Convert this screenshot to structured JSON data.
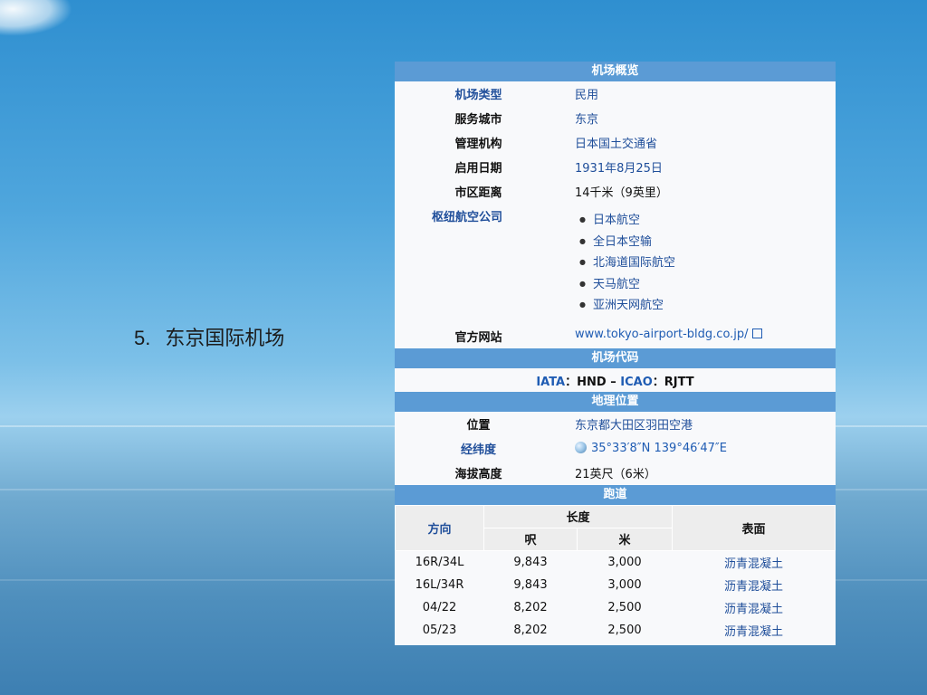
{
  "slide": {
    "number": "5.",
    "title": "东京国际机场"
  },
  "infobox": {
    "header_overview": "机场概览",
    "rows": [
      {
        "label": "机场类型",
        "value": "民用",
        "label_link": true,
        "value_link": true
      },
      {
        "label": "服务城市",
        "value": "东京",
        "label_link": false,
        "value_link": true
      },
      {
        "label": "管理机构",
        "value": "日本国土交通省",
        "label_link": false,
        "value_link": true
      },
      {
        "label": "启用日期",
        "value": "1931年8月25日",
        "label_link": false,
        "value_link": true
      },
      {
        "label": "市区距离",
        "value": "14千米（9英里）",
        "label_link": false,
        "value_link": false
      }
    ],
    "hub_label": "枢纽航空公司",
    "hubs": [
      "日本航空",
      "全日本空输",
      "北海道国际航空",
      "天马航空",
      "亚洲天网航空"
    ],
    "website_label": "官方网站",
    "website": "www.tokyo-airport-bldg.co.jp/",
    "header_codes": "机场代码",
    "codes": {
      "iata_label": "IATA",
      "iata_sep": "：",
      "iata": "HND",
      "dash": " – ",
      "icao_label": "ICAO",
      "icao_sep": "：",
      "icao": "RJTT"
    },
    "header_geo": "地理位置",
    "geo": {
      "location_label": "位置",
      "location": "东京都大田区羽田空港",
      "coord_label": "经纬度",
      "coord": "35°33′8″N 139°46′47″E",
      "elev_label": "海拔高度",
      "elev": "21英尺（6米）"
    },
    "header_runways": "跑道",
    "runway_head": {
      "direction": "方向",
      "length": "长度",
      "surface": "表面",
      "ft": "呎",
      "m": "米"
    },
    "runways": [
      {
        "dir": "16R/34L",
        "ft": "9,843",
        "m": "3,000",
        "surface": "沥青混凝土"
      },
      {
        "dir": "16L/34R",
        "ft": "9,843",
        "m": "3,000",
        "surface": "沥青混凝土"
      },
      {
        "dir": "04/22",
        "ft": "8,202",
        "m": "2,500",
        "surface": "沥青混凝土"
      },
      {
        "dir": "05/23",
        "ft": "8,202",
        "m": "2,500",
        "surface": "沥青混凝土"
      }
    ]
  }
}
